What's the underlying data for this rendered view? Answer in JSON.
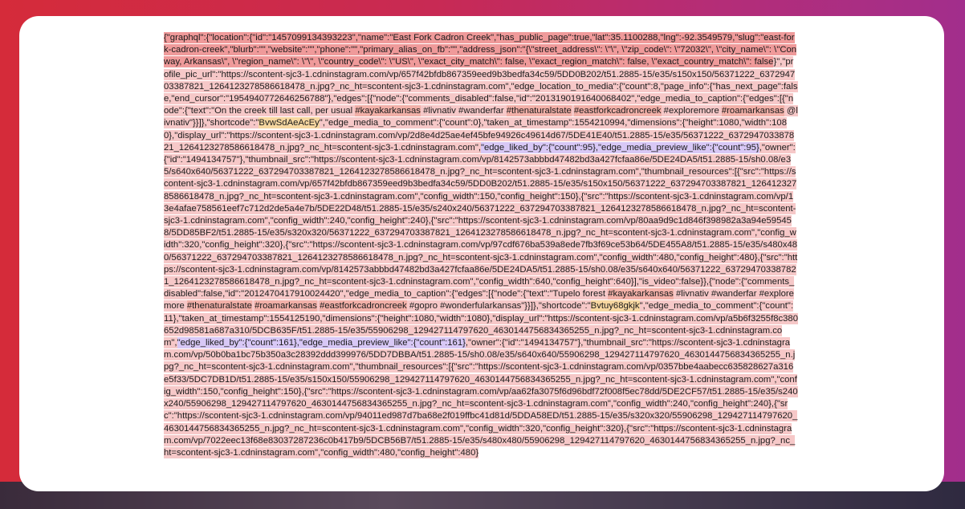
{
  "json_text": {
    "segments": [
      {
        "t": "{\"graphql\":{\"location\":{\"id\":\"1457099134393223\",\"name\":\"East Fork Cadron Creek\",\"has_public_page\":true,\"lat\":35.1100288,\"lng\":-92.3549579,\"slug\":\"east-fork-cadron-creek\",\"blurb\":\"\",\"website\":\"\",\"phone\":\"\",\"primary_alias_on_fb\":\"\",\"address_json\":\"{\\\"street_address\\\": \\\"\\\", \\\"zip_code\\\": \\\"72032\\\", \\\"city_name\\\": \\\"Conway, Arkansas\\\", \\\"region_name\\\": \\\"\\\", \\\"country_code\\\": \\\"US\\\", \\\"exact_city_match\\\": false, \\\"exact_region_match\\\": false, \\\"exact_country_match\\\": false",
        "h": "red"
      },
      {
        "t": "}\",\"profile_pic_url\":\"https://scontent-sjc3-1.cdninstagram.com/vp/657f42bfdb867359eed9b3bedfa34c59/5DD0B202/t51.2885-15/e35/s150x150/56371222_637294703387821_1264123278586618478_n.jpg?_nc_ht=scontent-sjc3-1.cdninstagram.com\",\"edge_location_to_media\":{\"count\":8,\"page_info\":{\"has_next_page\":false,\"end_cursor\":\"1954940772646256788\"},\"edges\":[{\"node\":{\"comments_disabled\":false,\"id\":\"2013190191640068402\",\"edge_media_to_caption\":{\"edges\":[{\"node\":{\"text\":\"On the creek till last call, per usual ",
        "h": "pink"
      },
      {
        "t": "#kayakarkansas",
        "h": "tag"
      },
      {
        "t": " #livnativ #wanderfar ",
        "h": "pink"
      },
      {
        "t": "#thenaturalstate",
        "h": "tag"
      },
      {
        "t": " ",
        "h": "pink"
      },
      {
        "t": "#eastforkcadroncreek",
        "h": "tag"
      },
      {
        "t": " #exploremore ",
        "h": "pink"
      },
      {
        "t": "#roamarkansas",
        "h": "tag"
      },
      {
        "t": " @livnativ\"}}]},\"shortcode\":\"",
        "h": "pink"
      },
      {
        "t": "BvwSdAeAcEy",
        "h": "shortcode"
      },
      {
        "t": "\",\"edge_media_to_comment\":{\"count\":0},\"taken_at_timestamp\":1554210994,\"dimensions\":{\"height\":1080,\"width\":1080},\"display_url\":\"https://scontent-sjc3-1.cdninstagram.com/vp/2d8e4d25ae4ef45bfe94926c49614d67/5DE41E40/t51.2885-15/e35/56371222_637294703387821_1264123278586618478_n.jpg?_nc_ht=scontent-sjc3-1.cdninstagram.com\",",
        "h": "pink"
      },
      {
        "t": "\"edge_liked_by\":{\"count\":95},\"edge_media_preview_like\":{\"count\":95}",
        "h": "purple"
      },
      {
        "t": ",\"owner\":{\"id\":\"1494134757\"},\"thumbnail_src\":\"https://scontent-sjc3-1.cdninstagram.com/vp/8142573abbbd47482bd3a427fcfaa86e/5DE24DA5/t51.2885-15/sh0.08/e35/s640x640/56371222_637294703387821_1264123278586618478_n.jpg?_nc_ht=scontent-sjc3-1.cdninstagram.com\",\"thumbnail_resources\":[{\"src\":\"https://scontent-sjc3-1.cdninstagram.com/vp/657f42bfdb867359eed9b3bedfa34c59/5DD0B202/t51.2885-15/e35/s150x150/56371222_637294703387821_1264123278586618478_n.jpg?_nc_ht=scontent-sjc3-1.cdninstagram.com\",\"config_width\":150,\"config_height\":150},{\"src\":\"https://scontent-sjc3-1.cdninstagram.com/vp/13e4afae758561eef7c712d2de5a4e7b/5DE22D48/t51.2885-15/e35/s240x240/56371222_637294703387821_1264123278586618478_n.jpg?_nc_ht=scontent-sjc3-1.cdninstagram.com\",\"config_width\":240,\"config_height\":240},{\"src\":\"https://scontent-sjc3-1.cdninstagram.com/vp/80aa9d9c1d846f398982a3a94e595458/5DD85BF2/t51.2885-15/e35/s320x320/56371222_637294703387821_1264123278586618478_n.jpg?_nc_ht=scontent-sjc3-1.cdninstagram.com\",\"config_width\":320,\"config_height\":320},{\"src\":\"https://scontent-sjc3-1.cdninstagram.com/vp/97cdf676ba539a8ede7fb3f69ce53b64/5DE455A8/t51.2885-15/e35/s480x480/56371222_637294703387821_1264123278586618478_n.jpg?_nc_ht=scontent-sjc3-1.cdninstagram.com\",\"config_width\":480,\"config_height\":480},{\"src\":\"https://scontent-sjc3-1.cdninstagram.com/vp/8142573abbbd47482bd3a427fcfaa86e/5DE24DA5/t51.2885-15/sh0.08/e35/s640x640/56371222_637294703387821_1264123278586618478_n.jpg?_nc_ht=scontent-sjc3-1.cdninstagram.com\",\"config_width\":640,\"config_height\":640}],\"is_video\":false}},{\"node\":{\"comments_disabled\":false,\"id\":\"2012470417910024420\",\"edge_media_to_caption\":{\"edges\":[{\"node\":{\"text\":\"Tupelo forest ",
        "h": "pink"
      },
      {
        "t": "#kayakarkansas",
        "h": "tag"
      },
      {
        "t": " #livnativ #wanderfar #exploremore ",
        "h": "pink"
      },
      {
        "t": "#thenaturalstate",
        "h": "tag"
      },
      {
        "t": " ",
        "h": "pink"
      },
      {
        "t": "#roamarkansas",
        "h": "tag"
      },
      {
        "t": " ",
        "h": "pink"
      },
      {
        "t": "#eastforkcadroncreek",
        "h": "tag"
      },
      {
        "t": " #gopro #wonderfularkansas\"}}]},\"shortcode\":\"",
        "h": "pink"
      },
      {
        "t": "Bvtuy68gkjk",
        "h": "shortcode"
      },
      {
        "t": "\",\"edge_media_to_comment\":{\"count\":11},\"taken_at_timestamp\":1554125190,\"dimensions\":{\"height\":1080,\"width\":1080},\"display_url\":\"https://scontent-sjc3-1.cdninstagram.com/vp/a5b6f3255f8c380652d98581a687a310/5DCB635F/t51.2885-15/e35/55906298_129427114797620_4630144756834365255_n.jpg?_nc_ht=scontent-sjc3-1.cdninstagram.com\",",
        "h": "pink"
      },
      {
        "t": "\"edge_liked_by\":{\"count\":161},\"edge_media_preview_like\":{\"count\":161}",
        "h": "purple"
      },
      {
        "t": ",\"owner\":{\"id\":\"1494134757\"},\"thumbnail_src\":\"https://scontent-sjc3-1.cdninstagram.com/vp/50b0ba1bc75b350a3c28392ddd399976/5DD7DBBA/t51.2885-15/sh0.08/e35/s640x640/55906298_129427114797620_4630144756834365255_n.jpg?_nc_ht=scontent-sjc3-1.cdninstagram.com\",\"thumbnail_resources\":[{\"src\":\"https://scontent-sjc3-1.cdninstagram.com/vp/0357bbe4aabecc635828627a316e5f33/5DC7DB1D/t51.2885-15/e35/s150x150/55906298_129427114797620_4630144756834365255_n.jpg?_nc_ht=scontent-sjc3-1.cdninstagram.com\",\"config_width\":150,\"config_height\":150},{\"src\":\"https://scontent-sjc3-1.cdninstagram.com/vp/aa62fa3075f6d96bdf72f008f5ec78dd/5DE2CF57/t51.2885-15/e35/s240x240/55906298_129427114797620_4630144756834365255_n.jpg?_nc_ht=scontent-sjc3-1.cdninstagram.com\",\"config_width\":240,\"config_height\":240},{\"src\":\"https://scontent-sjc3-1.cdninstagram.com/vp/94011ed987d7ba68e2f019ffbc41d81d/5DDA58ED/t51.2885-15/e35/s320x320/55906298_129427114797620_4630144756834365255_n.jpg?_nc_ht=scontent-sjc3-1.cdninstagram.com\",\"config_width\":320,\"config_height\":320},{\"src\":\"https://scontent-sjc3-1.cdninstagram.com/vp/7022eec13f68e83037287236c0b417b9/5DCB56B7/t51.2885-15/e35/s480x480/55906298_129427114797620_4630144756834365255_n.jpg?_nc_ht=scontent-sjc3-1.cdninstagram.com\",\"config_width\":480,\"config_height\":480}",
        "h": "pink"
      }
    ]
  }
}
